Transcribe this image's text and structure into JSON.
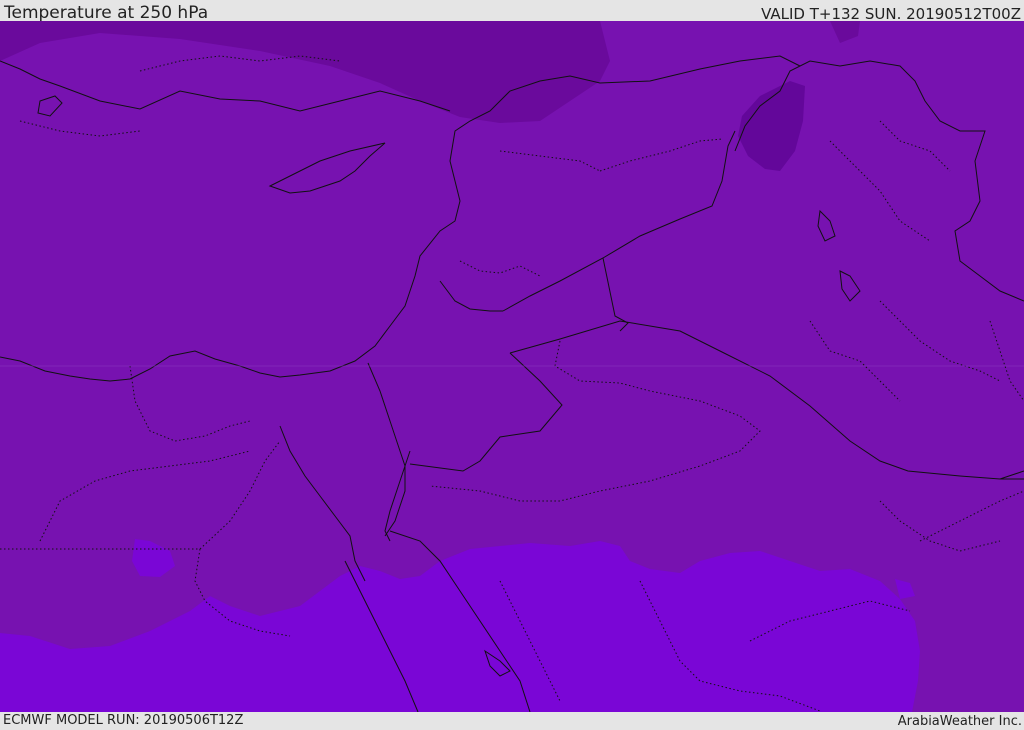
{
  "header": {
    "title": "Temperature at 250 hPa",
    "valid": "VALID T+132 SUN. 20190512T00Z"
  },
  "footer": {
    "model_run": "ECMWF MODEL RUN: 20190506T12Z",
    "credit": "ArabiaWeather Inc."
  },
  "colors": {
    "background_field": "#7712b0",
    "cold_band": "#6a0a9c",
    "colder_core": "#63079a",
    "warm_south": "#7a06d6",
    "border_lines": "#111111",
    "header_bg": "#e5e5e5"
  }
}
